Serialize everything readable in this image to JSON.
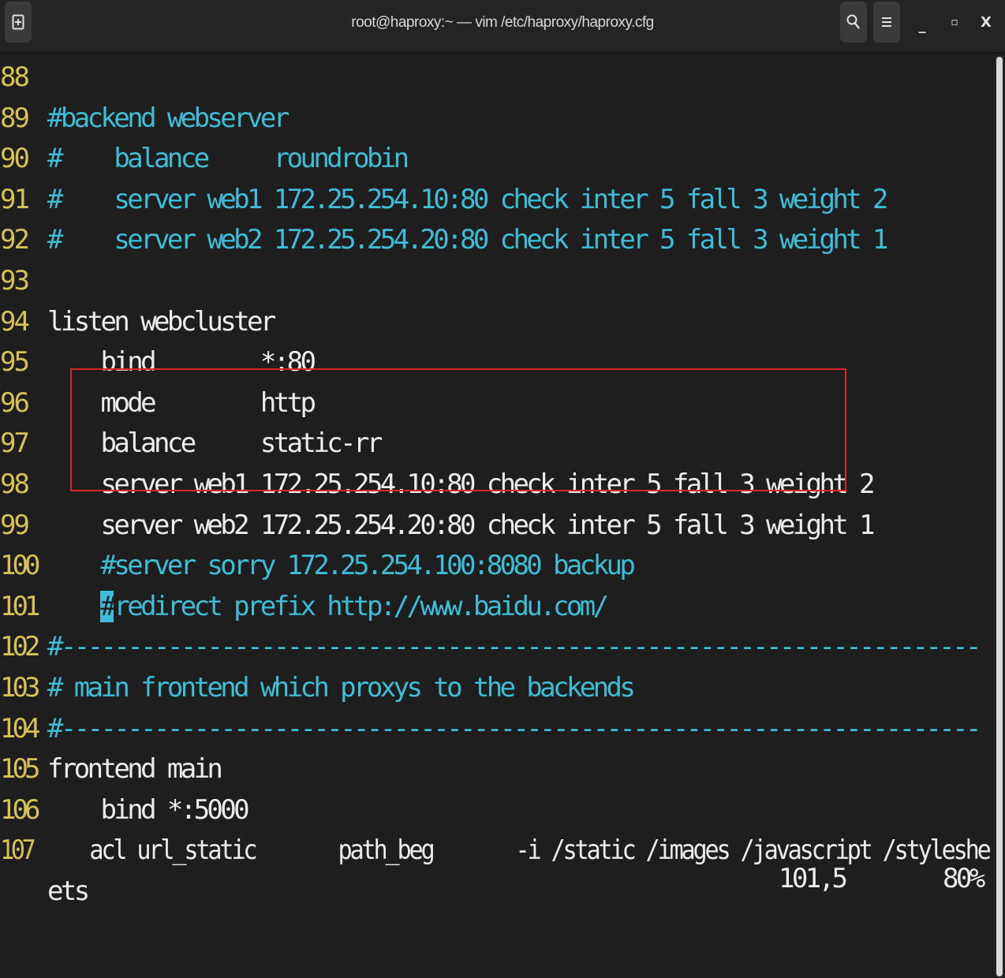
{
  "window": {
    "title": "root@haproxy:~ — vim /etc/haproxy/haproxy.cfg",
    "new_tab_icon": "new-tab-icon",
    "search_icon": "search-icon",
    "menu_icon": "hamburger-menu-icon",
    "minimize_label": "_",
    "maximize_label": "▫",
    "close_label": "X"
  },
  "colors": {
    "background": "#1e1e1e",
    "line_number": "#d4c257",
    "comment": "#3fbcd6",
    "text": "#ececec",
    "highlight_box": "#e0242c"
  },
  "editor": {
    "lines": [
      {
        "num": "88",
        "segments": [],
        "comment": false
      },
      {
        "num": "89",
        "segments": [
          {
            "text": "#backend webserver",
            "type": "comment"
          }
        ]
      },
      {
        "num": "90",
        "segments": [
          {
            "text": "#    balance     roundrobin",
            "type": "comment"
          }
        ]
      },
      {
        "num": "91",
        "segments": [
          {
            "text": "#    server web1 172.25.254.10:80 check inter 5 fall 3 weight 2",
            "type": "comment"
          }
        ]
      },
      {
        "num": "92",
        "segments": [
          {
            "text": "#    server web2 172.25.254.20:80 check inter 5 fall 3 weight 1",
            "type": "comment"
          }
        ]
      },
      {
        "num": "93",
        "segments": []
      },
      {
        "num": "94",
        "segments": [
          {
            "text": "listen webcluster",
            "type": "code"
          }
        ]
      },
      {
        "num": "95",
        "segments": [
          {
            "text": "    bind        *:80",
            "type": "code"
          }
        ]
      },
      {
        "num": "96",
        "segments": [
          {
            "text": "    mode        http",
            "type": "code"
          }
        ]
      },
      {
        "num": "97",
        "segments": [
          {
            "text": "    balance     static-rr",
            "type": "code"
          }
        ]
      },
      {
        "num": "98",
        "segments": [
          {
            "text": "    server web1 172.25.254.10:80 check inter 5 fall 3 weight 2",
            "type": "code"
          }
        ]
      },
      {
        "num": "99",
        "segments": [
          {
            "text": "    server web2 172.25.254.20:80 check inter 5 fall 3 weight 1",
            "type": "code"
          }
        ]
      },
      {
        "num": "100",
        "segments": [
          {
            "text": "    #server sorry 172.25.254.100:8080 backup",
            "type": "comment"
          }
        ]
      },
      {
        "num": "101",
        "segments": [
          {
            "text": "    ",
            "type": "code"
          },
          {
            "text": "#",
            "type": "cursor"
          },
          {
            "text": "redirect prefix http://www.baidu.com/",
            "type": "comment"
          }
        ]
      },
      {
        "num": "102",
        "segments": [
          {
            "text": "#---------------------------------------------------------------------",
            "type": "comment"
          }
        ]
      },
      {
        "num": "103",
        "segments": [
          {
            "text": "# main frontend which proxys to the backends",
            "type": "comment"
          }
        ]
      },
      {
        "num": "104",
        "segments": [
          {
            "text": "#---------------------------------------------------------------------",
            "type": "comment"
          }
        ]
      },
      {
        "num": "105",
        "segments": [
          {
            "text": "frontend main",
            "type": "code"
          }
        ]
      },
      {
        "num": "106",
        "segments": [
          {
            "text": "    bind *:5000",
            "type": "code"
          }
        ]
      },
      {
        "num": "107",
        "segments": [
          {
            "text": "    acl url_static       path_beg       -i /static /images /javascript /styleshe",
            "type": "code"
          }
        ]
      },
      {
        "num": "",
        "segments": [
          {
            "text": "ets",
            "type": "code"
          }
        ]
      }
    ]
  },
  "statusline": {
    "position": "101,5",
    "percent": "80%"
  }
}
